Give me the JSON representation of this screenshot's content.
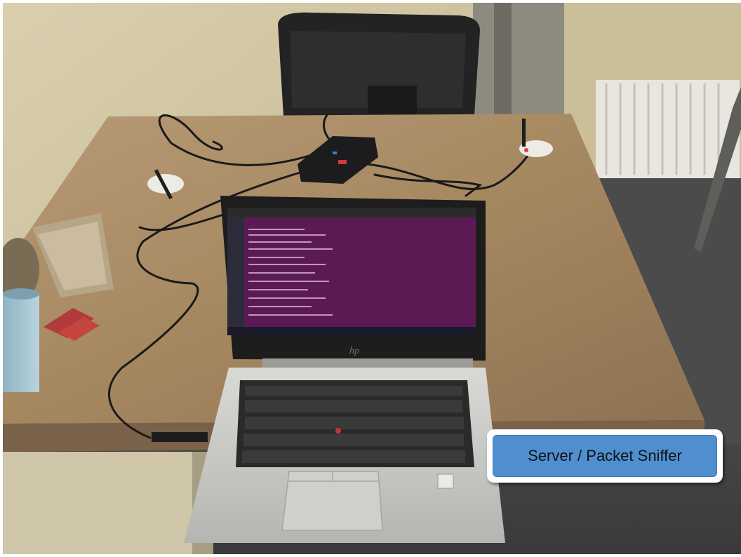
{
  "caption": {
    "label": "Server / Packet Sniffer"
  },
  "colors": {
    "caption_fill": "#4f8fd0",
    "terminal_purple": "#5c1a54",
    "desk_wood": "#a88a68",
    "laptop_silver": "#c9c9c7"
  },
  "objects": {
    "laptop_logo": "hp-logo-icon",
    "usb_dongles": [
      "usb-radio-dongle-icon",
      "usb-radio-dongle-icon"
    ]
  }
}
